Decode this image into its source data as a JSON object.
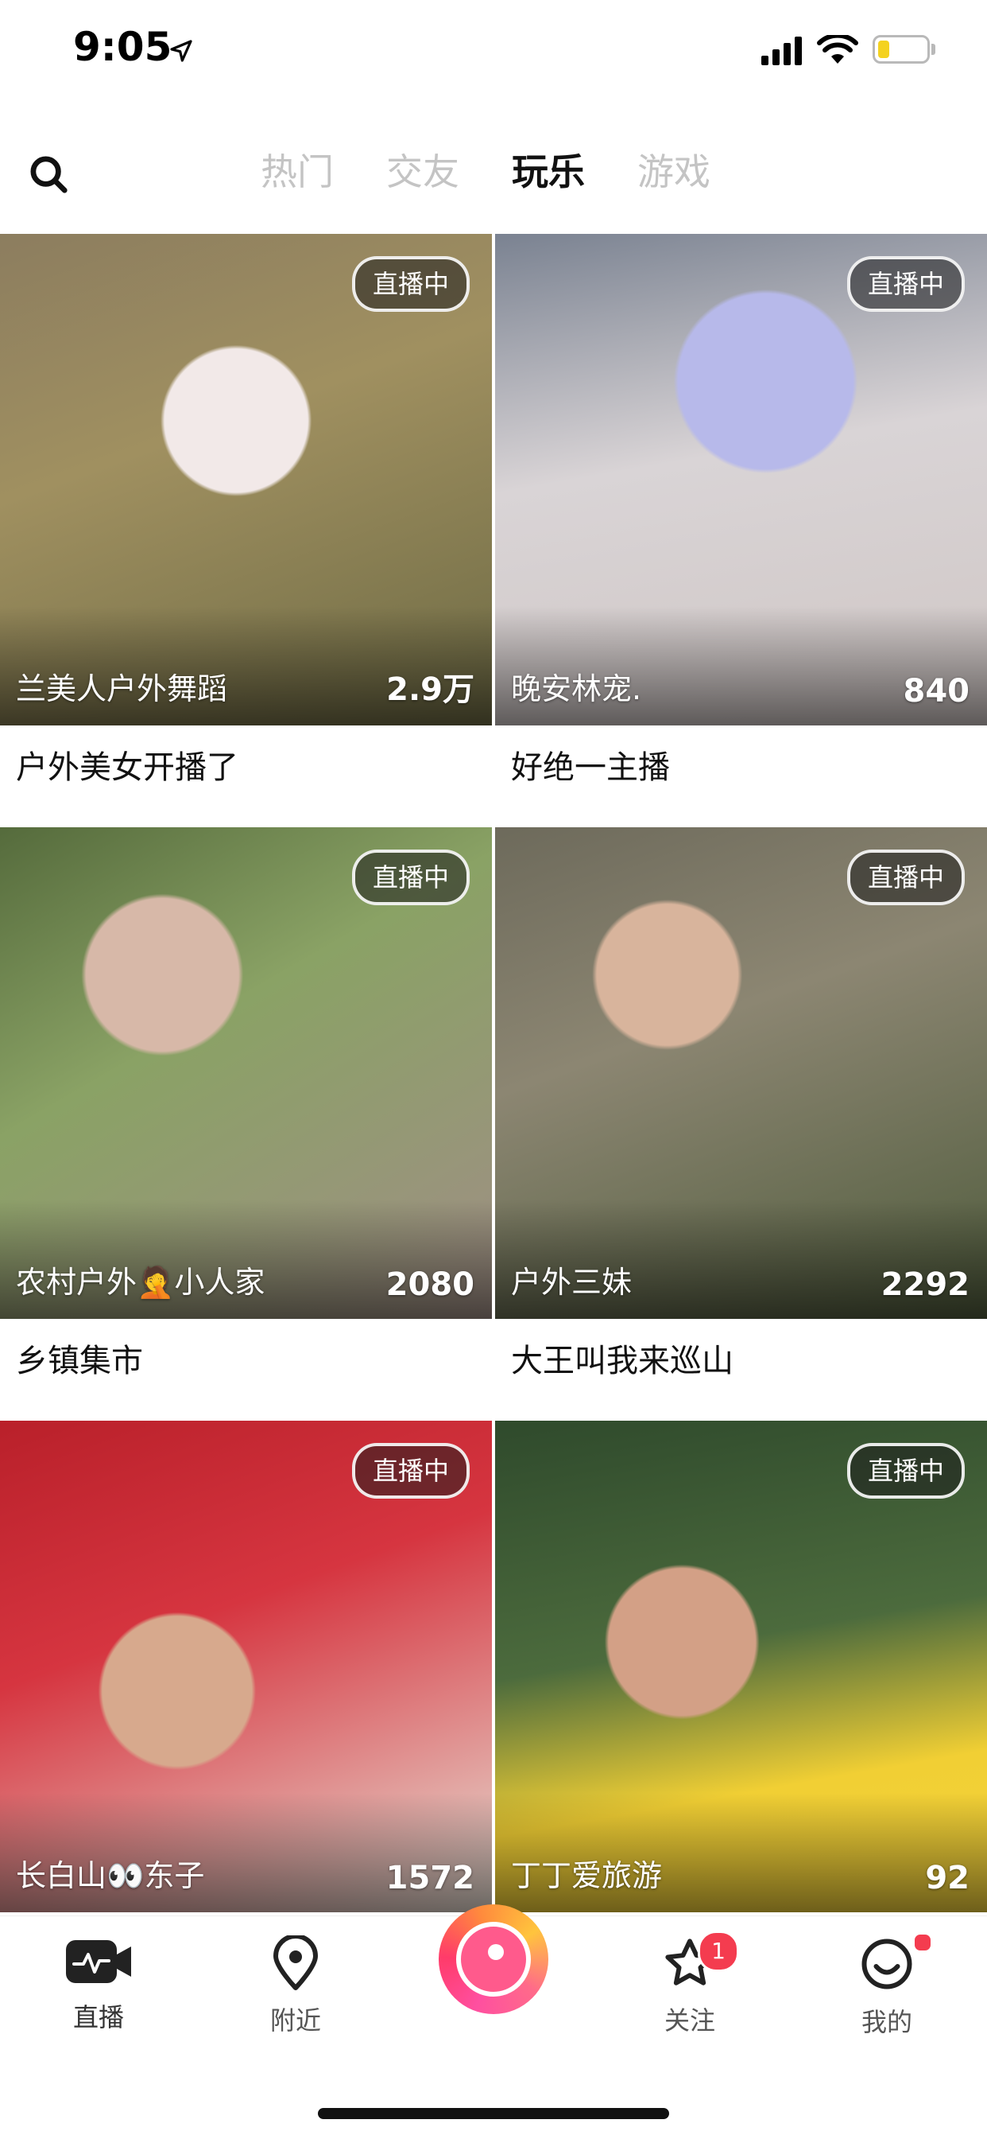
{
  "status_bar": {
    "time": "9:05"
  },
  "header": {
    "tabs": [
      {
        "label": "热门",
        "active": false
      },
      {
        "label": "交友",
        "active": false
      },
      {
        "label": "玩乐",
        "active": true
      },
      {
        "label": "游戏",
        "active": false
      }
    ]
  },
  "cards": [
    {
      "badge": "直播中",
      "streamer": "兰美人户外舞蹈",
      "viewers": "2.9万",
      "caption": "户外美女开播了"
    },
    {
      "badge": "直播中",
      "streamer": "晚安林宠.",
      "viewers": "840",
      "caption": "好绝一主播"
    },
    {
      "badge": "直播中",
      "streamer": "农村户外🤦小人家",
      "viewers": "2080",
      "caption": "乡镇集市"
    },
    {
      "badge": "直播中",
      "streamer": "户外三妹",
      "viewers": "2292",
      "caption": "大王叫我来巡山"
    },
    {
      "badge": "直播中",
      "streamer": "长白山👀东子",
      "viewers": "1572",
      "caption": ""
    },
    {
      "badge": "直播中",
      "streamer": "丁丁爱旅游",
      "viewers": "92",
      "caption": ""
    }
  ],
  "bottom_nav": {
    "items": [
      {
        "label": "直播",
        "icon": "live-camera-icon"
      },
      {
        "label": "附近",
        "icon": "location-pin-icon"
      },
      {
        "label": "关注",
        "icon": "star-icon",
        "badge": "1"
      },
      {
        "label": "我的",
        "icon": "smiley-face-icon"
      }
    ]
  },
  "colors": {
    "accent": "#f43c4f",
    "tab_inactive": "#c4c4c4",
    "tab_active": "#111111"
  }
}
